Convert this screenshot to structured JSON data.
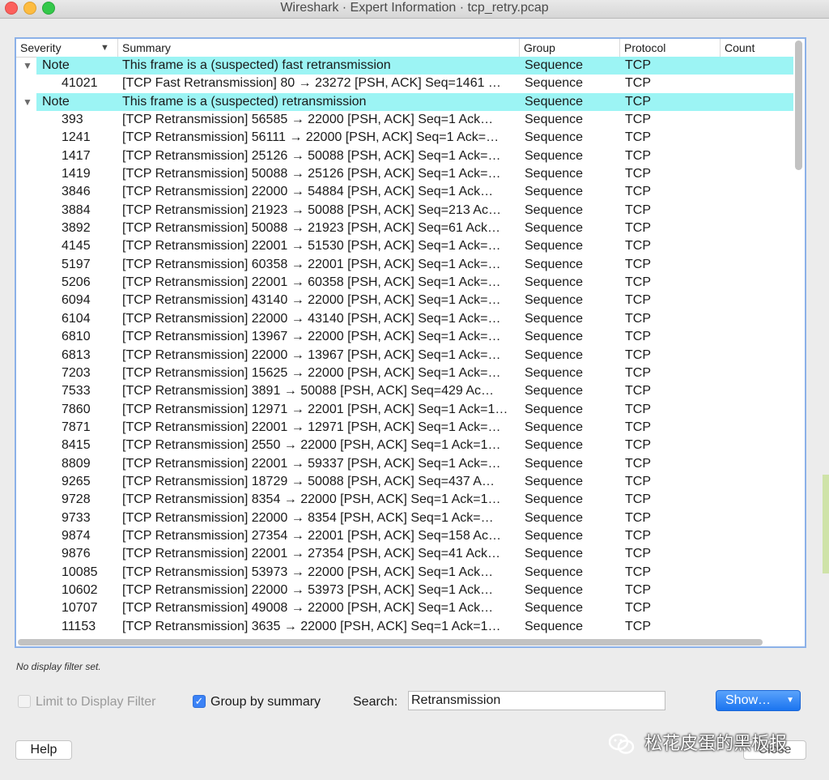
{
  "window": {
    "title": "Wireshark · Expert Information · tcp_retry.pcap"
  },
  "columns": {
    "severity": "Severity",
    "summary": "Summary",
    "group": "Group",
    "protocol": "Protocol",
    "count": "Count"
  },
  "groups": [
    {
      "severity": "Note",
      "summary": "This frame is a (suspected) fast retransmission",
      "group": "Sequence",
      "protocol": "TCP",
      "items": [
        {
          "frame": "41021",
          "summary": "[TCP Fast Retransmission] 80 → 23272 [PSH, ACK] Seq=1461 …",
          "group": "Sequence",
          "protocol": "TCP"
        }
      ]
    },
    {
      "severity": "Note",
      "summary": "This frame is a (suspected) retransmission",
      "group": "Sequence",
      "protocol": "TCP",
      "items": [
        {
          "frame": "393",
          "summary": "[TCP Retransmission] 56585 → 22000 [PSH, ACK] Seq=1 Ack…",
          "group": "Sequence",
          "protocol": "TCP"
        },
        {
          "frame": "1241",
          "summary": "[TCP Retransmission] 56111 → 22000 [PSH, ACK] Seq=1 Ack=…",
          "group": "Sequence",
          "protocol": "TCP"
        },
        {
          "frame": "1417",
          "summary": "[TCP Retransmission] 25126 → 50088 [PSH, ACK] Seq=1 Ack=…",
          "group": "Sequence",
          "protocol": "TCP"
        },
        {
          "frame": "1419",
          "summary": "[TCP Retransmission] 50088 → 25126 [PSH, ACK] Seq=1 Ack=…",
          "group": "Sequence",
          "protocol": "TCP"
        },
        {
          "frame": "3846",
          "summary": "[TCP Retransmission] 22000 → 54884 [PSH, ACK] Seq=1 Ack…",
          "group": "Sequence",
          "protocol": "TCP"
        },
        {
          "frame": "3884",
          "summary": "[TCP Retransmission] 21923 → 50088 [PSH, ACK] Seq=213 Ac…",
          "group": "Sequence",
          "protocol": "TCP"
        },
        {
          "frame": "3892",
          "summary": "[TCP Retransmission] 50088 → 21923 [PSH, ACK] Seq=61 Ack…",
          "group": "Sequence",
          "protocol": "TCP"
        },
        {
          "frame": "4145",
          "summary": "[TCP Retransmission] 22001 → 51530 [PSH, ACK] Seq=1 Ack=…",
          "group": "Sequence",
          "protocol": "TCP"
        },
        {
          "frame": "5197",
          "summary": "[TCP Retransmission] 60358 → 22001 [PSH, ACK] Seq=1 Ack=…",
          "group": "Sequence",
          "protocol": "TCP"
        },
        {
          "frame": "5206",
          "summary": "[TCP Retransmission] 22001 → 60358 [PSH, ACK] Seq=1 Ack=…",
          "group": "Sequence",
          "protocol": "TCP"
        },
        {
          "frame": "6094",
          "summary": "[TCP Retransmission] 43140 → 22000 [PSH, ACK] Seq=1 Ack=…",
          "group": "Sequence",
          "protocol": "TCP"
        },
        {
          "frame": "6104",
          "summary": "[TCP Retransmission] 22000 → 43140 [PSH, ACK] Seq=1 Ack=…",
          "group": "Sequence",
          "protocol": "TCP"
        },
        {
          "frame": "6810",
          "summary": "[TCP Retransmission] 13967 → 22000 [PSH, ACK] Seq=1 Ack=…",
          "group": "Sequence",
          "protocol": "TCP"
        },
        {
          "frame": "6813",
          "summary": "[TCP Retransmission] 22000 → 13967 [PSH, ACK] Seq=1 Ack=…",
          "group": "Sequence",
          "protocol": "TCP"
        },
        {
          "frame": "7203",
          "summary": "[TCP Retransmission] 15625 → 22000 [PSH, ACK] Seq=1 Ack=…",
          "group": "Sequence",
          "protocol": "TCP"
        },
        {
          "frame": "7533",
          "summary": "[TCP Retransmission] 3891 → 50088 [PSH, ACK] Seq=429 Ac…",
          "group": "Sequence",
          "protocol": "TCP"
        },
        {
          "frame": "7860",
          "summary": "[TCP Retransmission] 12971 → 22001 [PSH, ACK] Seq=1 Ack=1…",
          "group": "Sequence",
          "protocol": "TCP"
        },
        {
          "frame": "7871",
          "summary": "[TCP Retransmission] 22001 → 12971 [PSH, ACK] Seq=1 Ack=…",
          "group": "Sequence",
          "protocol": "TCP"
        },
        {
          "frame": "8415",
          "summary": "[TCP Retransmission] 2550 → 22000 [PSH, ACK] Seq=1 Ack=1…",
          "group": "Sequence",
          "protocol": "TCP"
        },
        {
          "frame": "8809",
          "summary": "[TCP Retransmission] 22001 → 59337 [PSH, ACK] Seq=1 Ack=…",
          "group": "Sequence",
          "protocol": "TCP"
        },
        {
          "frame": "9265",
          "summary": "[TCP Retransmission] 18729 → 50088 [PSH, ACK] Seq=437 A…",
          "group": "Sequence",
          "protocol": "TCP"
        },
        {
          "frame": "9728",
          "summary": "[TCP Retransmission] 8354 → 22000 [PSH, ACK] Seq=1 Ack=1…",
          "group": "Sequence",
          "protocol": "TCP"
        },
        {
          "frame": "9733",
          "summary": "[TCP Retransmission] 22000 → 8354 [PSH, ACK] Seq=1 Ack=…",
          "group": "Sequence",
          "protocol": "TCP"
        },
        {
          "frame": "9874",
          "summary": "[TCP Retransmission] 27354 → 22001 [PSH, ACK] Seq=158 Ac…",
          "group": "Sequence",
          "protocol": "TCP"
        },
        {
          "frame": "9876",
          "summary": "[TCP Retransmission] 22001 → 27354 [PSH, ACK] Seq=41 Ack…",
          "group": "Sequence",
          "protocol": "TCP"
        },
        {
          "frame": "10085",
          "summary": "[TCP Retransmission] 53973 → 22000 [PSH, ACK] Seq=1 Ack…",
          "group": "Sequence",
          "protocol": "TCP"
        },
        {
          "frame": "10602",
          "summary": "[TCP Retransmission] 22000 → 53973 [PSH, ACK] Seq=1 Ack…",
          "group": "Sequence",
          "protocol": "TCP"
        },
        {
          "frame": "10707",
          "summary": "[TCP Retransmission] 49008 → 22000 [PSH, ACK] Seq=1 Ack…",
          "group": "Sequence",
          "protocol": "TCP"
        },
        {
          "frame": "11153",
          "summary": "[TCP Retransmission] 3635 → 22000 [PSH, ACK] Seq=1 Ack=1…",
          "group": "Sequence",
          "protocol": "TCP"
        }
      ]
    }
  ],
  "status": {
    "filter_text": "No display filter set."
  },
  "controls": {
    "limit_label": "Limit to Display Filter",
    "limit_checked": false,
    "group_label": "Group by summary",
    "group_checked": true,
    "search_label": "Search:",
    "search_value": "Retransmission",
    "show_label": "Show…",
    "help_label": "Help",
    "close_label": "Close"
  },
  "watermark": {
    "text": "松花皮蛋的黑板报"
  },
  "colors": {
    "group_highlight": "#9cf4f4",
    "accent": "#1a74f0",
    "panel_border": "#8cb1e8"
  }
}
